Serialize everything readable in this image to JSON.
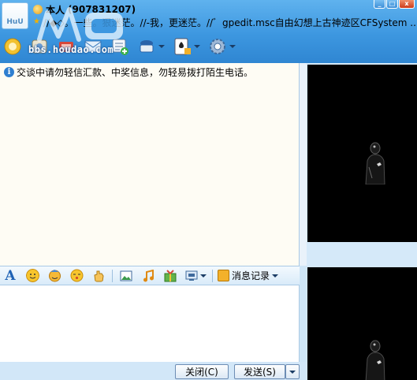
{
  "window": {
    "contact_name": "本人",
    "contact_id": "(907831207)",
    "signature": "//◆◇。一些。狠迷茫。//-我，更迷茫。//゛gpedit.msc自由幻想上古神迹区CFSystem ..",
    "avatar_text": "HuU",
    "controls": {
      "minimize": "_",
      "maximize": "□",
      "close": "x"
    }
  },
  "watermark": {
    "text": "bbs.houdao.com"
  },
  "toolbar": {
    "items": [
      {
        "icon": "video-call-icon"
      },
      {
        "icon": "voice-icon"
      },
      {
        "icon": "file-transfer-icon"
      },
      {
        "icon": "mail-icon"
      },
      {
        "icon": "add-app-icon"
      },
      {
        "icon": "remote-assist-icon",
        "dropdown": true
      },
      {
        "icon": "game-icon",
        "dropdown": true
      },
      {
        "icon": "settings-icon",
        "dropdown": true
      }
    ]
  },
  "chat": {
    "notice": "交谈中请勿轻信汇款、中奖信息，勿轻易拨打陌生电话。"
  },
  "format_bar": {
    "history_label": "消息记录"
  },
  "buttons": {
    "close": "关闭(C)",
    "send": "发送(S)"
  },
  "colors": {
    "header": "#3d97e0",
    "history_bg": "#fefcf4",
    "video_bg": "#000000"
  }
}
